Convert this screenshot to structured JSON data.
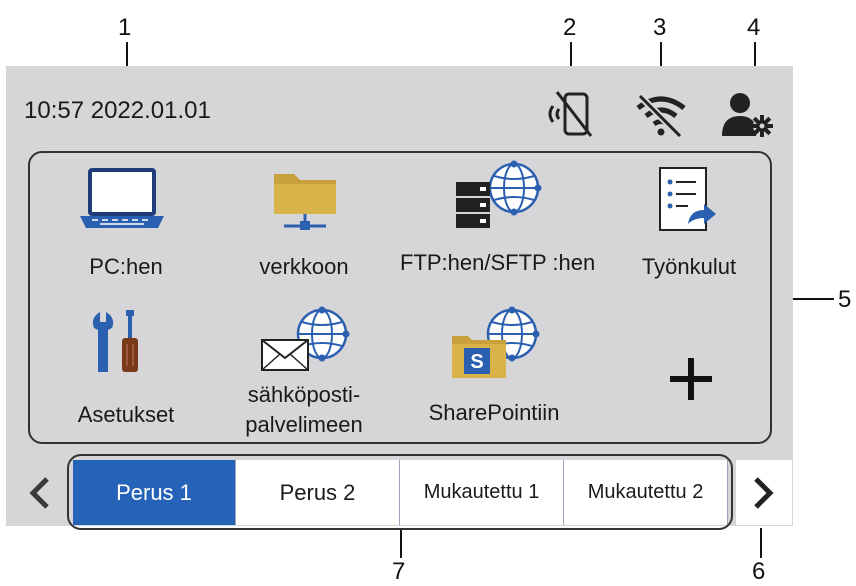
{
  "callouts": {
    "c1": "1",
    "c2": "2",
    "c3": "3",
    "c4": "4",
    "c5": "5",
    "c6": "6",
    "c7": "7"
  },
  "status": {
    "datetime": "10:57 2022.01.01",
    "icons": [
      "wireless-direct-off-icon",
      "wifi-off-icon",
      "user-settings-icon"
    ]
  },
  "tiles": [
    {
      "label": "PC:hen",
      "icon": "laptop-icon"
    },
    {
      "label": "verkkoon",
      "icon": "network-folder-icon"
    },
    {
      "label": "FTP:hen/SFTP :hen",
      "icon": "ftp-server-icon"
    },
    {
      "label": "Työnkulut",
      "icon": "workflow-icon"
    },
    {
      "label": "Asetukset",
      "icon": "settings-tools-icon"
    },
    {
      "label": "sähköposti- palvelimeen",
      "icon": "email-server-icon"
    },
    {
      "label": "SharePointiin",
      "icon": "sharepoint-icon"
    },
    {
      "label": "",
      "icon": "add-icon"
    }
  ],
  "tabs": [
    {
      "label": "Perus 1",
      "active": true
    },
    {
      "label": "Perus 2",
      "active": false
    },
    {
      "label": "Mukautettu 1",
      "active": false
    },
    {
      "label": "Mukautettu 2",
      "active": false
    }
  ],
  "colors": {
    "screen": "#d6d6d8",
    "active_tab": "#2563b8",
    "icon_blue": "#2b5fb0",
    "folder": "#c9a13a"
  }
}
